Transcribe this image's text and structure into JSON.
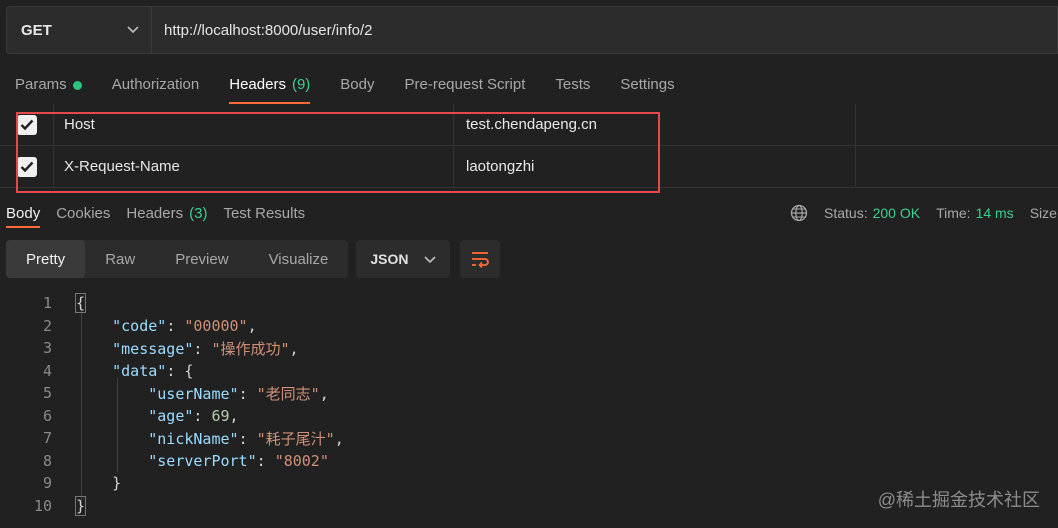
{
  "request": {
    "method": "GET",
    "url": "http://localhost:8000/user/info/2"
  },
  "request_tabs": [
    {
      "label": "Params",
      "badge": "",
      "active": false
    },
    {
      "label": "Authorization",
      "badge": "",
      "active": false
    },
    {
      "label": "Headers",
      "badge": "(9)",
      "active": true
    },
    {
      "label": "Body",
      "badge": "",
      "active": false
    },
    {
      "label": "Pre-request Script",
      "badge": "",
      "active": false
    },
    {
      "label": "Tests",
      "badge": "",
      "active": false
    },
    {
      "label": "Settings",
      "badge": "",
      "active": false
    }
  ],
  "headers": [
    {
      "key": "Host",
      "value": "test.chendapeng.cn",
      "checked": true
    },
    {
      "key": "X-Request-Name",
      "value": "laotongzhi",
      "checked": true
    }
  ],
  "response_tabs": [
    {
      "label": "Body",
      "badge": ""
    },
    {
      "label": "Cookies",
      "badge": ""
    },
    {
      "label": "Headers",
      "badge": "(3)"
    },
    {
      "label": "Test Results",
      "badge": ""
    }
  ],
  "response_status": {
    "status_label": "Status:",
    "status_value": "200 OK",
    "time_label": "Time:",
    "time_value": "14 ms",
    "size_label": "Size"
  },
  "view_modes": [
    "Pretty",
    "Raw",
    "Preview",
    "Visualize"
  ],
  "format": "JSON",
  "code_lines": [
    {
      "n": "1",
      "parts": [
        [
          "p",
          "{"
        ]
      ]
    },
    {
      "n": "2",
      "parts": [
        [
          "p",
          "    "
        ],
        [
          "k",
          "\"code\""
        ],
        [
          "p",
          ": "
        ],
        [
          "s",
          "\"00000\""
        ],
        [
          "p",
          ","
        ]
      ]
    },
    {
      "n": "3",
      "parts": [
        [
          "p",
          "    "
        ],
        [
          "k",
          "\"message\""
        ],
        [
          "p",
          ": "
        ],
        [
          "s",
          "\"操作成功\""
        ],
        [
          "p",
          ","
        ]
      ]
    },
    {
      "n": "4",
      "parts": [
        [
          "p",
          "    "
        ],
        [
          "k",
          "\"data\""
        ],
        [
          "p",
          ": {"
        ]
      ]
    },
    {
      "n": "5",
      "parts": [
        [
          "p",
          "        "
        ],
        [
          "k",
          "\"userName\""
        ],
        [
          "p",
          ": "
        ],
        [
          "s",
          "\"老同志\""
        ],
        [
          "p",
          ","
        ]
      ]
    },
    {
      "n": "6",
      "parts": [
        [
          "p",
          "        "
        ],
        [
          "k",
          "\"age\""
        ],
        [
          "p",
          ": "
        ],
        [
          "n",
          "69"
        ],
        [
          "p",
          ","
        ]
      ]
    },
    {
      "n": "7",
      "parts": [
        [
          "p",
          "        "
        ],
        [
          "k",
          "\"nickName\""
        ],
        [
          "p",
          ": "
        ],
        [
          "s",
          "\"耗子尾汁\""
        ],
        [
          "p",
          ","
        ]
      ]
    },
    {
      "n": "8",
      "parts": [
        [
          "p",
          "        "
        ],
        [
          "k",
          "\"serverPort\""
        ],
        [
          "p",
          ": "
        ],
        [
          "s",
          "\"8002\""
        ]
      ]
    },
    {
      "n": "9",
      "parts": [
        [
          "p",
          "    }"
        ]
      ]
    },
    {
      "n": "10",
      "parts": [
        [
          "p",
          "}"
        ]
      ]
    }
  ],
  "watermark": "@稀土掘金技术社区",
  "colors": {
    "accent": "#ff6c37",
    "success": "#3ecf8e",
    "highlight_border": "#e5484d"
  }
}
